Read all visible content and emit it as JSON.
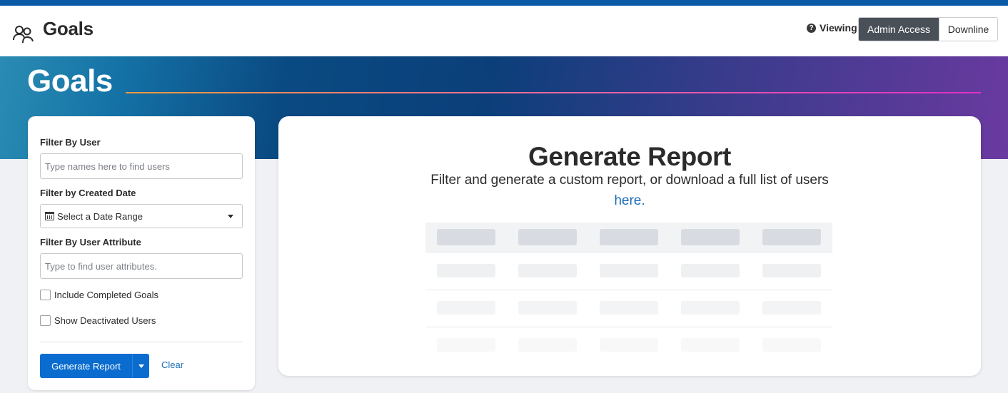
{
  "header": {
    "app_title": "Goals",
    "viewing_label": "Viewing",
    "access_options": [
      "Admin Access",
      "Downline"
    ],
    "active_option": "Admin Access"
  },
  "banner": {
    "title": "Goals"
  },
  "filters": {
    "user_label": "Filter By User",
    "user_placeholder": "Type names here to find users",
    "date_label": "Filter by Created Date",
    "date_select_value": "Select a Date Range",
    "attribute_label": "Filter By User Attribute",
    "attribute_placeholder": "Type to find user attributes.",
    "include_completed_label": "Include Completed Goals",
    "show_deactivated_label": "Show Deactivated Users",
    "generate_button": "Generate Report",
    "clear_link": "Clear"
  },
  "report": {
    "title": "Generate Report",
    "description": "Filter and generate a custom report, or download a full list of users",
    "link_text": "here."
  },
  "colors": {
    "primary_button": "#0a6ccf",
    "link": "#1a6bb8",
    "active_toggle": "#4a5057",
    "top_stripe": "#0a5aa8"
  }
}
